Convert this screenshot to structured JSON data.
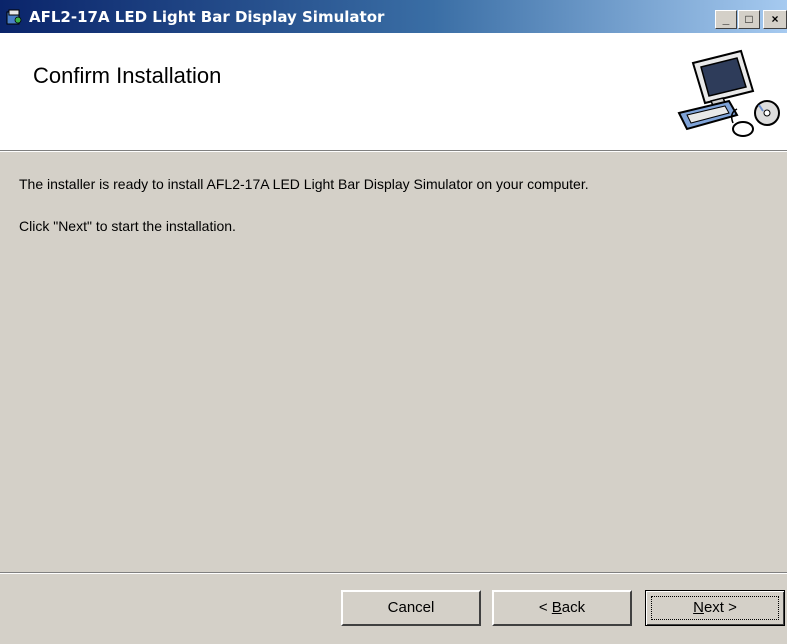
{
  "window": {
    "title": "AFL2-17A LED Light Bar Display Simulator",
    "controls": {
      "minimize": "_",
      "maximize": "□",
      "close": "×"
    }
  },
  "header": {
    "title": "Confirm Installation",
    "icon": "computer-cd-icon"
  },
  "body": {
    "line1": "The installer is ready to install AFL2-17A LED Light Bar Display Simulator on your computer.",
    "line2": "Click \"Next\" to start the installation."
  },
  "buttons": {
    "cancel": "Cancel",
    "back_prefix": "< ",
    "back_mnemonic": "B",
    "back_rest": "ack",
    "next_mnemonic": "N",
    "next_rest": "ext >"
  },
  "colors": {
    "titlebar_start": "#0a246a",
    "titlebar_end": "#a6caf0",
    "dialog_bg": "#d4d0c8",
    "header_bg": "#ffffff"
  }
}
